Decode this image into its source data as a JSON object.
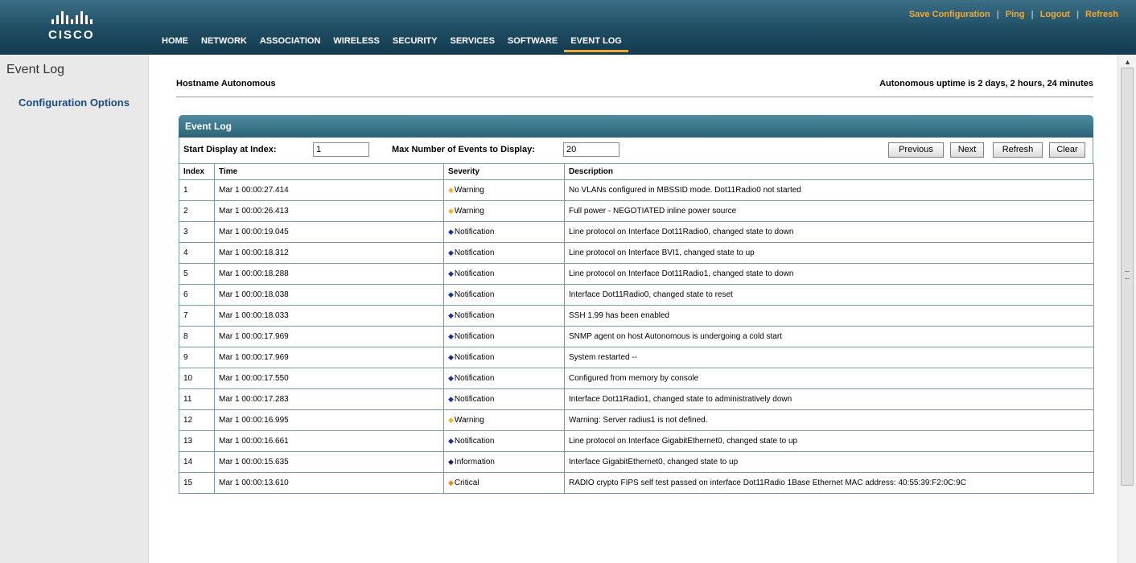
{
  "header": {
    "logo_text": "CISCO",
    "top_links": [
      "Save Configuration",
      "Ping",
      "Logout",
      "Refresh"
    ],
    "nav": [
      "HOME",
      "NETWORK",
      "ASSOCIATION",
      "WIRELESS",
      "SECURITY",
      "SERVICES",
      "SOFTWARE",
      "EVENT LOG"
    ],
    "active_nav": "EVENT LOG",
    "accent_color": "#f2a931",
    "bg_color": "#1f4d63"
  },
  "sidebar": {
    "title": "Event Log",
    "link": "Configuration Options"
  },
  "main": {
    "hostname_label": "Hostname  Autonomous",
    "uptime": "Autonomous uptime is 2 days, 2 hours, 24 minutes"
  },
  "panel": {
    "title": "Event Log",
    "start_index_label": "Start Display at Index:",
    "start_index_value": "1",
    "max_events_label": "Max Number of Events to Display:",
    "max_events_value": "20",
    "buttons": [
      "Previous",
      "Next",
      "Refresh",
      "Clear"
    ],
    "columns": [
      "Index",
      "Time",
      "Severity",
      "Description"
    ]
  },
  "severity_colors": {
    "Warning": "#f2b429",
    "Notification": "#1a2fa0",
    "Information": "#1a2466",
    "Critical": "#e8891c"
  },
  "events": [
    {
      "index": "1",
      "time": "Mar 1 00:00:27.414",
      "severity": "Warning",
      "description": "No VLANs configured in MBSSID mode. Dot11Radio0 not started"
    },
    {
      "index": "2",
      "time": "Mar 1 00:00:26.413",
      "severity": "Warning",
      "description": "Full power - NEGOTIATED inline power source"
    },
    {
      "index": "3",
      "time": "Mar 1 00:00:19.045",
      "severity": "Notification",
      "description": "Line protocol on Interface Dot11Radio0, changed state to down"
    },
    {
      "index": "4",
      "time": "Mar 1 00:00:18.312",
      "severity": "Notification",
      "description": "Line protocol on Interface BVI1, changed state to up"
    },
    {
      "index": "5",
      "time": "Mar 1 00:00:18.288",
      "severity": "Notification",
      "description": "Line protocol on Interface Dot11Radio1, changed state to down"
    },
    {
      "index": "6",
      "time": "Mar 1 00:00:18.038",
      "severity": "Notification",
      "description": "Interface Dot11Radio0, changed state to reset"
    },
    {
      "index": "7",
      "time": "Mar 1 00:00:18.033",
      "severity": "Notification",
      "description": "SSH 1.99 has been enabled"
    },
    {
      "index": "8",
      "time": "Mar 1 00:00:17.969",
      "severity": "Notification",
      "description": "SNMP agent on host Autonomous is undergoing a cold start"
    },
    {
      "index": "9",
      "time": "Mar 1 00:00:17.969",
      "severity": "Notification",
      "description": "System restarted --"
    },
    {
      "index": "10",
      "time": "Mar 1 00:00:17.550",
      "severity": "Notification",
      "description": "Configured from memory by console"
    },
    {
      "index": "11",
      "time": "Mar 1 00:00:17.283",
      "severity": "Notification",
      "description": "Interface Dot11Radio1, changed state to administratively down"
    },
    {
      "index": "12",
      "time": "Mar 1 00:00:16.995",
      "severity": "Warning",
      "description": "Warning: Server radius1 is not defined."
    },
    {
      "index": "13",
      "time": "Mar 1 00:00:16.661",
      "severity": "Notification",
      "description": "Line protocol on Interface GigabitEthernet0, changed state to up"
    },
    {
      "index": "14",
      "time": "Mar 1 00:00:15.635",
      "severity": "Information",
      "description": "Interface GigabitEthernet0, changed state to up"
    },
    {
      "index": "15",
      "time": "Mar 1 00:00:13.610",
      "severity": "Critical",
      "description": "RADIO crypto FIPS self test passed on interface Dot11Radio 1Base Ethernet MAC address: 40:55:39:F2:0C:9C"
    }
  ]
}
